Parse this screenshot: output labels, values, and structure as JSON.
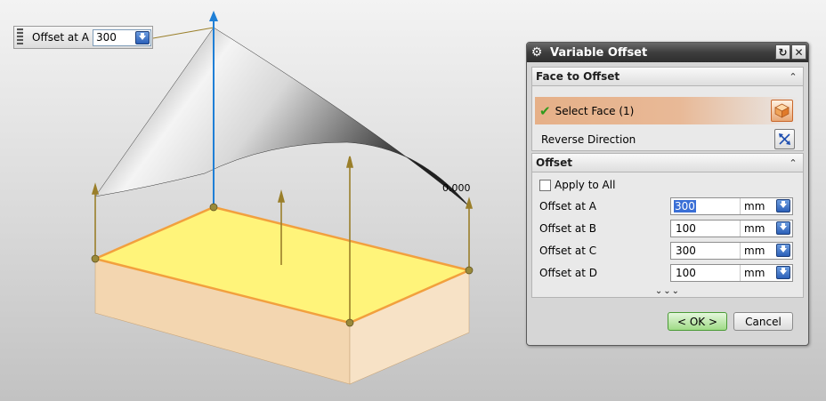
{
  "callout": {
    "label": "Offset at A",
    "value": "300"
  },
  "viewport": {
    "annotation_value": "0.000"
  },
  "dialog": {
    "title": "Variable Offset",
    "face_group": {
      "title": "Face to Offset",
      "select_face_label": "Select Face (1)",
      "reverse_direction_label": "Reverse Direction"
    },
    "offset_group": {
      "title": "Offset",
      "apply_to_all_label": "Apply to All",
      "apply_to_all_checked": false,
      "fields": [
        {
          "label": "Offset at A",
          "value": "300",
          "unit": "mm"
        },
        {
          "label": "Offset at B",
          "value": "100",
          "unit": "mm"
        },
        {
          "label": "Offset at C",
          "value": "300",
          "unit": "mm"
        },
        {
          "label": "Offset at D",
          "value": "100",
          "unit": "mm"
        }
      ],
      "more_glyph": "⌄⌄⌄"
    },
    "ok_label": "< OK >",
    "cancel_label": "Cancel"
  },
  "colors": {
    "top_face": "#fff47a",
    "top_edge": "#f2a03e",
    "side_face": "#f3d6b0",
    "vector_blue": "#1f7fd6",
    "vector_gold": "#9a7f2a"
  }
}
